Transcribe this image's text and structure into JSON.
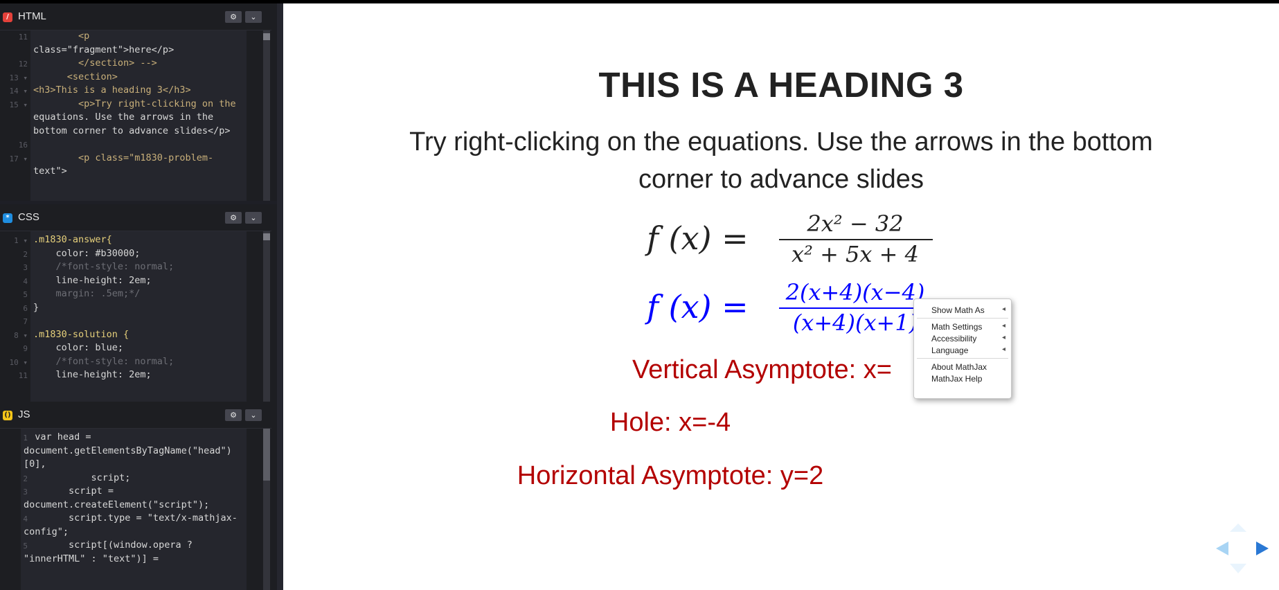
{
  "editor": {
    "html_pane": {
      "title": "HTML",
      "lines": [
        {
          "num": "11",
          "text": "        <p"
        },
        {
          "num": "",
          "text": "class=\"fragment\">here</p>"
        },
        {
          "num": "12",
          "text": "        </section> -->"
        },
        {
          "num": "13 ▾",
          "text": "      <section>"
        },
        {
          "num": "14 ▾",
          "text": "<h3>This is a heading 3</h3>"
        },
        {
          "num": "15 ▾",
          "text": "        <p>Try right-clicking on the"
        },
        {
          "num": "",
          "text": "equations. Use the arrows in the"
        },
        {
          "num": "",
          "text": "bottom corner to advance slides</p>"
        },
        {
          "num": "16",
          "text": ""
        },
        {
          "num": "17 ▾",
          "text": "        <p class=\"m1830-problem-"
        },
        {
          "num": "",
          "text": "text\">"
        }
      ]
    },
    "css_pane": {
      "title": "CSS",
      "lines": [
        {
          "num": "1 ▾",
          "text": ".m1830-answer{"
        },
        {
          "num": "2",
          "text": "    color: #b30000;"
        },
        {
          "num": "3",
          "text": "    /*font-style: normal;"
        },
        {
          "num": "4",
          "text": "    line-height: 2em;"
        },
        {
          "num": "5",
          "text": "    margin: .5em;*/"
        },
        {
          "num": "6",
          "text": "}"
        },
        {
          "num": "7",
          "text": ""
        },
        {
          "num": "8 ▾",
          "text": ".m1830-solution {"
        },
        {
          "num": "9",
          "text": "    color: blue;"
        },
        {
          "num": "10 ▾",
          "text": "    /*font-style: normal;"
        },
        {
          "num": "11",
          "text": "    line-height: 2em;"
        }
      ]
    },
    "js_pane": {
      "title": "JS",
      "lines": [
        {
          "num": "1",
          "text": "  var head ="
        },
        {
          "num": "",
          "text": "document.getElementsByTagName(\"head\")"
        },
        {
          "num": "",
          "text": "[0],"
        },
        {
          "num": "2",
          "text": "            script;"
        },
        {
          "num": "3",
          "text": "        script ="
        },
        {
          "num": "",
          "text": "document.createElement(\"script\");"
        },
        {
          "num": "4",
          "text": "        script.type = \"text/x-mathjax-"
        },
        {
          "num": "",
          "text": "config\";"
        },
        {
          "num": "5",
          "text": "        script[(window.opera ?"
        },
        {
          "num": "",
          "text": "\"innerHTML\" : \"text\")] ="
        }
      ]
    },
    "settings_icon": "gear-icon",
    "collapse_icon": "chevron-down-icon"
  },
  "slide": {
    "heading": "THIS IS A HEADING 3",
    "paragraph": "Try right-clicking on the equations. Use the arrows in the bottom corner to advance slides",
    "equation1": {
      "lhs": "f (x) =",
      "numerator": "2x² − 32",
      "denominator": "x² + 5x + 4",
      "color": "#222222"
    },
    "equation2": {
      "lhs": "f (x) =",
      "numerator": "2(x+4)(x−4)",
      "denominator": "(x+4)(x+1)",
      "color": "#0000ff"
    },
    "answers": {
      "vertical": "Vertical Asymptote: x=",
      "hole": "Hole: x=-4",
      "horizontal": "Horizontal Asymptote: y=2",
      "color": "#b30000"
    },
    "context_menu": {
      "items": [
        {
          "label": "Show Math As",
          "has_submenu": true
        },
        {
          "label": "Math Settings",
          "has_submenu": true
        },
        {
          "label": "Accessibility",
          "has_submenu": true
        },
        {
          "label": "Language",
          "has_submenu": true
        },
        {
          "label": "About MathJax",
          "has_submenu": false
        },
        {
          "label": "MathJax Help",
          "has_submenu": false
        }
      ]
    },
    "nav": {
      "left_icon": "arrow-left-icon",
      "right_icon": "arrow-right-icon",
      "up_icon": "arrow-up-icon",
      "down_icon": "arrow-down-icon",
      "accent": "#42affa"
    }
  }
}
